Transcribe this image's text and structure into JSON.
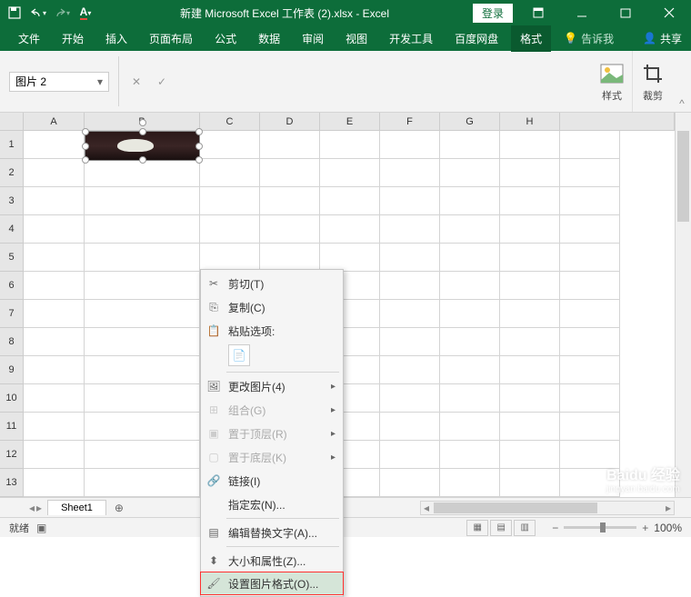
{
  "title": "新建 Microsoft Excel 工作表 (2).xlsx  -  Excel",
  "login": "登录",
  "ribbon": {
    "tabs": [
      "文件",
      "开始",
      "插入",
      "页面布局",
      "公式",
      "数据",
      "审阅",
      "视图",
      "开发工具",
      "百度网盘",
      "格式"
    ],
    "active": "格式",
    "tell": "告诉我",
    "share": "共享"
  },
  "namebox": "图片 2",
  "ribbon_groups": {
    "styles": "样式",
    "crop": "裁剪"
  },
  "columns": [
    "A",
    "B",
    "C",
    "D",
    "E",
    "F",
    "G",
    "H"
  ],
  "rows": [
    "1",
    "2",
    "3",
    "4",
    "5",
    "6",
    "7",
    "8",
    "9",
    "10",
    "11",
    "12",
    "13"
  ],
  "context_menu": {
    "cut": "剪切(T)",
    "copy": "复制(C)",
    "paste_label": "粘贴选项:",
    "change_pic": "更改图片(4)",
    "group": "组合(G)",
    "bring_front": "置于顶层(R)",
    "send_back": "置于底层(K)",
    "link": "链接(I)",
    "assign_macro": "指定宏(N)...",
    "alt_text": "编辑替换文字(A)...",
    "size_props": "大小和属性(Z)...",
    "format_pic": "设置图片格式(O)..."
  },
  "sheet_tab": "Sheet1",
  "status": {
    "ready": "就绪",
    "zoom": "100%"
  },
  "watermark": {
    "brand": "Baidu 经验",
    "url": "jingyan.baidu.com"
  }
}
